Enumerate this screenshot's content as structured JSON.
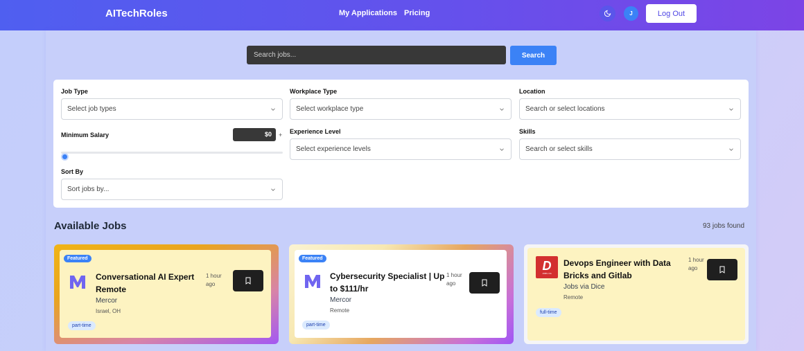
{
  "header": {
    "brand": "AITechRoles",
    "nav": [
      "My Applications",
      "Pricing"
    ],
    "user_initial": "J",
    "logout_label": "Log Out",
    "theme_icon": "moon-icon"
  },
  "search": {
    "placeholder": "Search jobs...",
    "button_label": "Search"
  },
  "filters": {
    "job_type": {
      "label": "Job Type",
      "placeholder": "Select job types"
    },
    "workplace_type": {
      "label": "Workplace Type",
      "placeholder": "Select workplace type"
    },
    "location": {
      "label": "Location",
      "placeholder": "Search or select locations"
    },
    "min_salary": {
      "label": "Minimum Salary",
      "value": "$0",
      "suffix": "+",
      "slider_fraction": 0
    },
    "experience": {
      "label": "Experience Level",
      "placeholder": "Select experience levels"
    },
    "skills": {
      "label": "Skills",
      "placeholder": "Search or select skills"
    },
    "sort": {
      "label": "Sort By",
      "placeholder": "Sort jobs by..."
    }
  },
  "jobs_section": {
    "title": "Available Jobs",
    "count": "93 jobs found"
  },
  "jobs": [
    {
      "featured": "Featured",
      "title": "Conversational AI Expert Remote",
      "company": "Mercor",
      "location": "Israel, OH",
      "time": "1 hour ago",
      "tag": "part-time",
      "logo": "mercor-logo"
    },
    {
      "featured": "Featured",
      "title": "Cybersecurity Specialist | Up to $111/hr",
      "company": "Mercor",
      "location": "Remote",
      "time": "1 hour ago",
      "tag": "part-time",
      "logo": "mercor-logo"
    },
    {
      "featured": "",
      "title": "Devops Engineer with Data Bricks and Gitlab",
      "company": "Jobs via Dice",
      "location": "Remote",
      "time": "1 hour ago",
      "tag": "full-time",
      "logo": "dice-logo",
      "logo_text": "JOBS VIA"
    }
  ],
  "colors": {
    "accent": "#3b82f6",
    "header_start": "#4f5ff0",
    "header_end": "#7c44e6",
    "card_fill": "#fdf3c1"
  }
}
